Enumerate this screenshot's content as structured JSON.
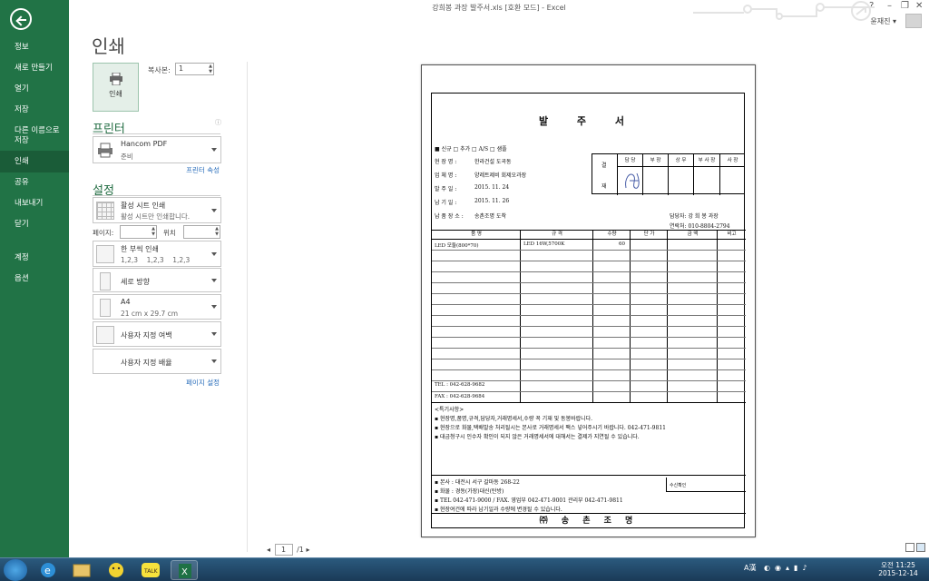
{
  "window": {
    "title": "강희봉 과장 발주서.xls  [호환 모드] - Excel",
    "help": "?",
    "minimize": "–",
    "restore": "❐",
    "close": "✕",
    "user_name": "윤재진 ▾"
  },
  "nav": {
    "items": [
      {
        "label": "정보"
      },
      {
        "label": "새로 만들기"
      },
      {
        "label": "열기"
      },
      {
        "label": "저장"
      },
      {
        "label": "다른 이름으로\n저장"
      },
      {
        "label": "인쇄"
      },
      {
        "label": "공유"
      },
      {
        "label": "내보내기"
      },
      {
        "label": "닫기"
      },
      {
        "label": "계정"
      },
      {
        "label": "옵션"
      }
    ]
  },
  "print": {
    "title": "인쇄",
    "button_label": "인쇄",
    "copies_label": "복사본:",
    "copies_value": "1",
    "printer_header": "프린터",
    "printer_name": "Hancom PDF",
    "printer_status": "준비",
    "printer_props_link": "프린터 속성",
    "settings_header": "설정",
    "scope_main": "활성 시트 인쇄",
    "scope_sub": "활성 시트만 인쇄합니다.",
    "pages_label": "페이지:",
    "to_label": "위치",
    "collate_main": "한 부씩 인쇄",
    "collate_sub": "1,2,3    1,2,3    1,2,3",
    "orientation": "세로 방향",
    "paper_main": "A4",
    "paper_sub": "21 cm x 29.7 cm",
    "margins": "사용자 지정 여백",
    "scaling": "사용자 지정 배율",
    "page_setup_link": "페이지 설정"
  },
  "preview": {
    "title": "발 주 서",
    "options": "■ 신규  □ 추가  □ A/S  □ 샘플",
    "fields": [
      {
        "label": "현 장 명 :",
        "value": "한라건설 도곡동"
      },
      {
        "label": "업 체 명 :",
        "value": "양레트제비 회제오과장"
      },
      {
        "label": "발 주 일 :",
        "value": "2015. 11. 24"
      },
      {
        "label": "납 기 일 :",
        "value": "2015. 11. 26"
      },
      {
        "label": "납 품 장 소 :",
        "value": "송촌조명 도착"
      }
    ],
    "approval": {
      "gyeol": "결",
      "jae": "재",
      "headers": [
        "담 당",
        "부 장",
        "상 무",
        "부 사 장",
        "사 장"
      ]
    },
    "contact_person": "담당자:    강 희 봉 과장",
    "contact_phone": "연락처:    010-8804-2794",
    "item_headers": [
      "품      명",
      "규      격",
      "수량",
      "단  가",
      "금  액",
      "비고"
    ],
    "item_row": {
      "name": "LED 모듈(800*70)",
      "spec": "LED 16W,5700K",
      "qty": "60"
    },
    "tel": "TEL : 042-628-9682",
    "fax": "FAX : 042-628-9684",
    "notes_title": "<특기사항>",
    "notes": [
      "▪ 현장명,품명,규격,담당자,거래명세서,수량 꼭 기재 및 동봉바랍니다.",
      "▪ 현장으로 화물,택배발송 처리될시는 본사로 거래명세서 팩스 넣어주시기 바랍니다.  042-471-9811",
      "▪ 대금청구시 인수자 확인이 되지 않은 거래명세서에 대해서는 결제가 지연될 수 있습니다."
    ],
    "footer": [
      "▪ 본사 : 대전시 서구 갈마동 268-22",
      "▪ 화물 : 경동(가장)대신(탄방)",
      "▪ TEL 042-471-9000 / FAX. 영업부 042-471-9001 관리부 042-471-9811",
      "▪ 현장여건에 따라 납기일과 수량에 변경될 수 있습니다."
    ],
    "suin": "수신확인",
    "company": "㈜ 송 촌 조 명"
  },
  "pagenav": {
    "current": "1",
    "total": "/1"
  },
  "taskbar": {
    "tray_text": "A漢",
    "time": "오전 11:25",
    "date": "2015-12-14"
  }
}
